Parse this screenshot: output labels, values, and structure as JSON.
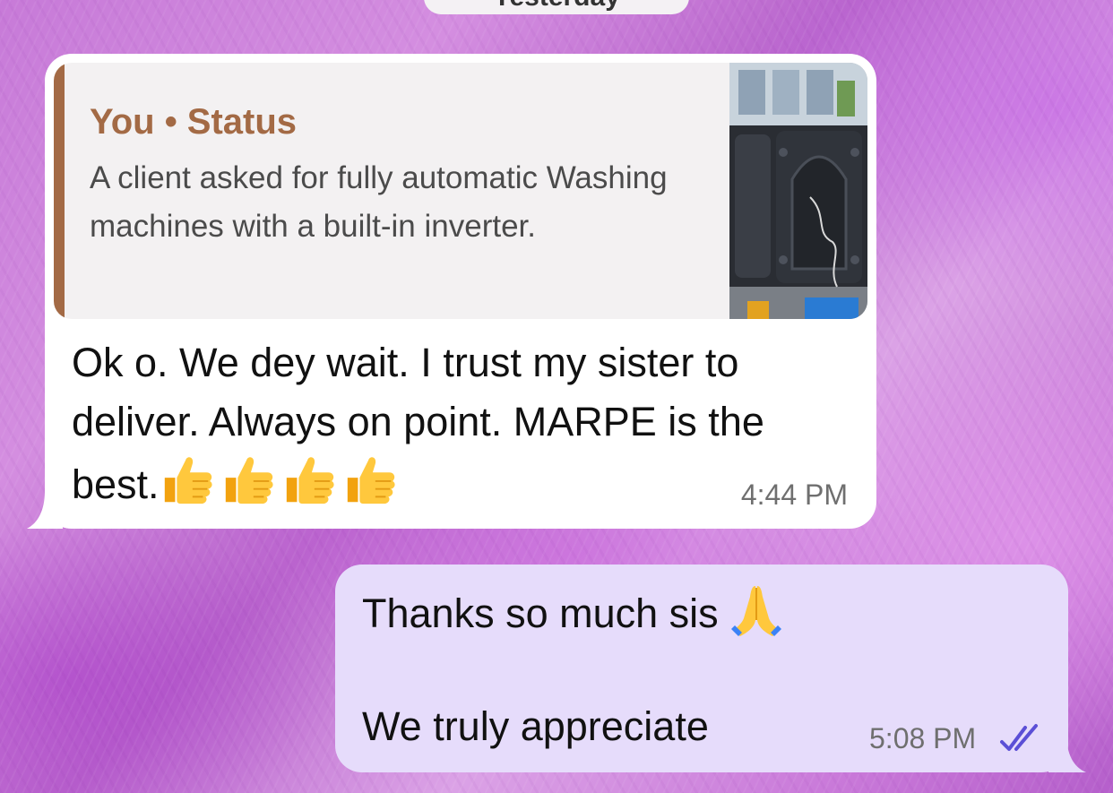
{
  "date_chip": {
    "label": "Yesterday"
  },
  "received_message": {
    "quote": {
      "author": "You • Status",
      "text": "A client asked for fully automatic Washing machines with a built-in inverter.",
      "thumbnail_icon": "washing-machine-photo"
    },
    "text": "Ok o. We dey wait. I trust my sister to deliver. Always on point. MARPE is the best.",
    "emoji_icons": [
      "thumbs-up-icon",
      "thumbs-up-icon",
      "thumbs-up-icon",
      "thumbs-up-icon"
    ],
    "time": "4:44 PM"
  },
  "sent_message": {
    "line1": "Thanks so much sis",
    "line1_emoji": "folded-hands-icon",
    "line2": "We truly appreciate",
    "time": "5:08 PM",
    "status_icon": "read-double-check-icon",
    "status_color": "#5b4fd6"
  },
  "colors": {
    "received_bubble": "#ffffff",
    "sent_bubble": "#e6dcfb",
    "quote_accent": "#a36a45"
  }
}
